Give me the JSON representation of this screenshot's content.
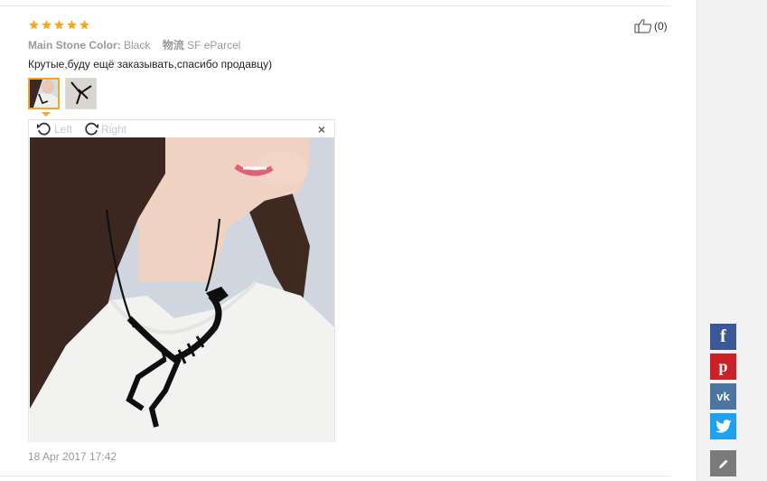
{
  "review": {
    "rating": 5,
    "props": [
      {
        "label": "Main Stone Color:",
        "value": "Black"
      },
      {
        "label": "物流",
        "value": "SF eParcel"
      }
    ],
    "text": "Крутые,буду ещё заказывать,спасибо продавцу)",
    "date": "18 Apr 2017 17:42"
  },
  "viewer": {
    "rotate_left": "Left",
    "rotate_right": "Right",
    "close": "×"
  },
  "like": {
    "count": "(0)"
  },
  "colors": {
    "star": "#f5a623",
    "facebook": "#3b5998",
    "pinterest": "#cb2027",
    "vk": "#4c75a3",
    "twitter": "#1da1f2",
    "edit": "#7a7a7a"
  },
  "share_icons": [
    "facebook-icon",
    "pinterest-icon",
    "vk-icon",
    "twitter-icon",
    "edit-icon"
  ]
}
